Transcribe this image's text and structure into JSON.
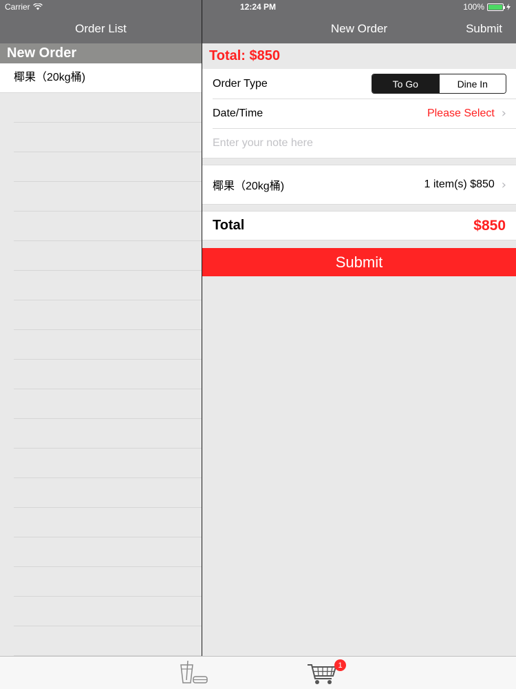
{
  "status": {
    "carrier": "Carrier",
    "time": "12:24 PM",
    "battery": "100%"
  },
  "left_nav": {
    "title": "Order List"
  },
  "left": {
    "section_header": "New Order",
    "items": [
      {
        "label": "椰果（20kg桶)"
      }
    ]
  },
  "right_nav": {
    "title": "New Order",
    "submit_label": "Submit"
  },
  "order": {
    "total_header": "Total: $850",
    "order_type_label": "Order Type",
    "segments": {
      "to_go": "To Go",
      "dine_in": "Dine In",
      "selected": "To Go"
    },
    "datetime_label": "Date/Time",
    "datetime_value": "Please Select",
    "note_placeholder": "Enter your note here",
    "line_items": [
      {
        "name": "椰果（20kg桶)",
        "summary": "1 item(s) $850"
      }
    ],
    "total_label": "Total",
    "total_amount": "$850",
    "submit_label": "Submit"
  },
  "tabbar": {
    "tabs": [
      {
        "icon": "drink-food-icon"
      },
      {
        "icon": "cart-icon",
        "badge": "1"
      }
    ]
  },
  "colors": {
    "accent_red": "#ff2020",
    "nav_grey": "#6e6e70",
    "section_grey": "#8e8e8c",
    "battery_green": "#4cd964"
  }
}
